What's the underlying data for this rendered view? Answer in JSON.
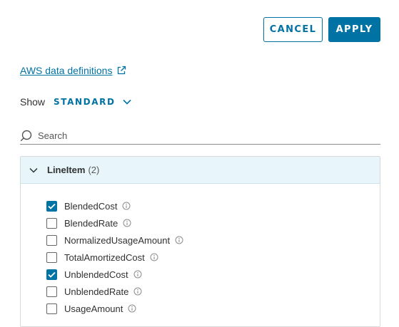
{
  "actions": {
    "cancel_label": "CANCEL",
    "apply_label": "APPLY"
  },
  "definitions_link": {
    "label": "AWS data definitions",
    "icon": "external-link-icon"
  },
  "show": {
    "label": "Show",
    "selected": "STANDARD"
  },
  "search": {
    "placeholder": "Search",
    "value": ""
  },
  "group": {
    "name": "LineItem",
    "count_text": "(2)",
    "expanded": true,
    "fields": [
      {
        "label": "BlendedCost",
        "checked": true
      },
      {
        "label": "BlendedRate",
        "checked": false
      },
      {
        "label": "NormalizedUsageAmount",
        "checked": false
      },
      {
        "label": "TotalAmortizedCost",
        "checked": false
      },
      {
        "label": "UnblendedCost",
        "checked": true
      },
      {
        "label": "UnblendedRate",
        "checked": false
      },
      {
        "label": "UsageAmount",
        "checked": false
      }
    ]
  },
  "colors": {
    "accent": "#0072a3",
    "header_bg": "#e8f6fc",
    "text": "#313131"
  }
}
